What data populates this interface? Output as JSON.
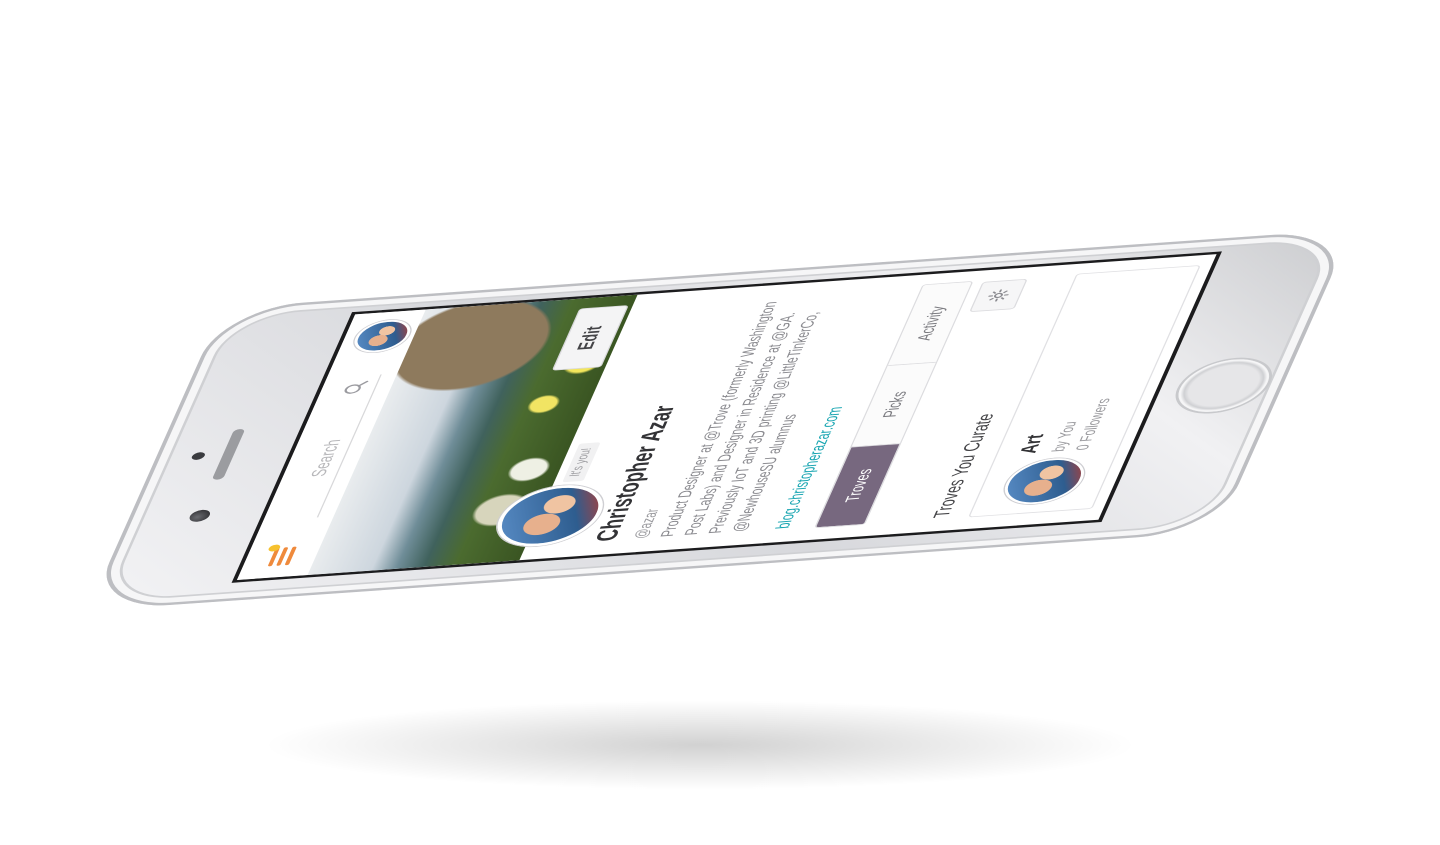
{
  "header": {
    "search": {
      "placeholder": "Search"
    }
  },
  "profile": {
    "edit_label": "Edit",
    "badge": "It's you!",
    "name": "Christopher Azar",
    "handle": "@azar",
    "bio": "Product Designer at @Trove (formerly Washington Post Labs) and Designer in Residence at @GA. Previously IoT and 3D printing @LittleTinkerCo, @NewhouseSU alumnus",
    "link": "blog.christopherazar.com"
  },
  "tabs": [
    {
      "label": "Troves",
      "active": true
    },
    {
      "label": "Picks",
      "active": false
    },
    {
      "label": "Activity",
      "active": false
    }
  ],
  "section": {
    "title": "Troves You Curate"
  },
  "troves": [
    {
      "name": "Art",
      "owner": "by You",
      "followers": "0 Followers"
    }
  ],
  "colors": {
    "accent_tab": "#77687f",
    "link": "#1aa6b2",
    "menu": "#ef8a3c",
    "notification_dot": "#f6c12e"
  },
  "icons": {
    "menu": "hamburger-icon",
    "search": "search-icon",
    "settings": "gear-icon"
  }
}
